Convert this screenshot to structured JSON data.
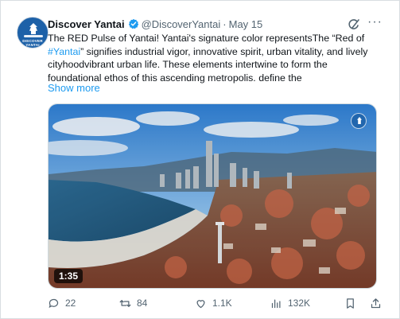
{
  "author": {
    "name": "Discover Yantai",
    "handle": "@DiscoverYantai",
    "separator": "·",
    "date": "May 15",
    "avatar_text_line1": "DISCOVER",
    "avatar_text_line2": "YANTAI"
  },
  "tweet": {
    "line1": "The RED Pulse of Yantai! Yantai's signature color representsThe “Red of",
    "line2_hashtag": "#Yantai",
    "line2_rest": "” signifies industrial vigor, innovative spirit, urban vitality, and lively",
    "line3": "cityhoodvibrant urban life. These elements intertwine to form the",
    "line4": "foundational ethos of this ascending metropolis. define the",
    "show_more": "Show more"
  },
  "media": {
    "duration": "1:35"
  },
  "actions": {
    "replies": "22",
    "reposts": "84",
    "likes": "1.1K",
    "views": "132K"
  },
  "colors": {
    "link": "#1d9bf0",
    "muted": "#536471",
    "verified": "#1d9bf0",
    "avatar_bg": "#1d61a8"
  },
  "icons": [
    "verified-badge-icon",
    "grok-icon",
    "more-options-icon",
    "reply-icon",
    "repost-icon",
    "like-icon",
    "views-icon",
    "bookmark-icon",
    "share-icon"
  ]
}
